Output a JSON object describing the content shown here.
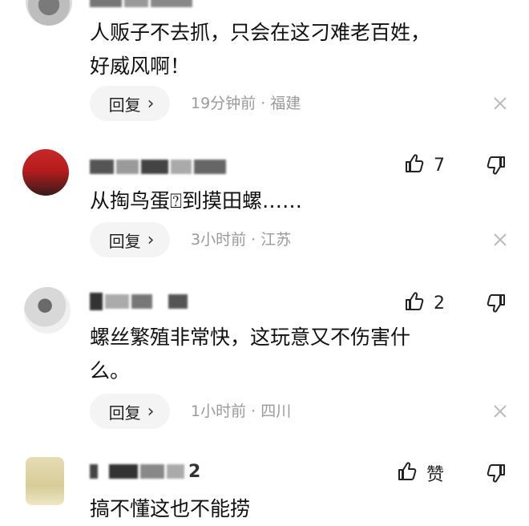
{
  "comments": [
    {
      "text_lines": [
        "人贩子不去抓，只会在这刁难老百姓，",
        "好威风啊！"
      ],
      "reply_label": "回复",
      "meta": "19分钟前 · 福建"
    },
    {
      "like_count": "7",
      "text_lines": [
        "从掏鸟蛋⍰到摸田螺……"
      ],
      "reply_label": "回复",
      "meta": "3小时前 · 江苏"
    },
    {
      "like_count": "2",
      "text_lines": [
        "螺丝繁殖非常快，这玩意又不伤害什",
        "么。"
      ],
      "reply_label": "回复",
      "meta": "1小时前 · 四川"
    },
    {
      "username_suffix": "2",
      "like_count": "赞",
      "text_lines": [
        "搞不懂这也不能捞"
      ]
    }
  ],
  "colors": {
    "meta_gray": "#9a9a9a",
    "reply_bg": "#f4f4f4"
  }
}
